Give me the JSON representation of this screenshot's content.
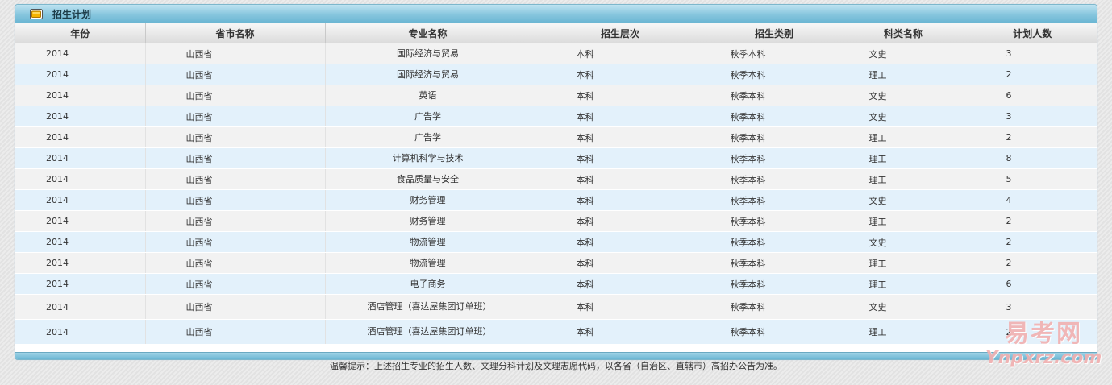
{
  "panel": {
    "title": "招生计划",
    "headers": [
      "年份",
      "省市名称",
      "专业名称",
      "招生层次",
      "招生类别",
      "科类名称",
      "计划人数"
    ],
    "rows": [
      [
        "2014",
        "山西省",
        "国际经济与贸易",
        "本科",
        "秋季本科",
        "文史",
        "3"
      ],
      [
        "2014",
        "山西省",
        "国际经济与贸易",
        "本科",
        "秋季本科",
        "理工",
        "2"
      ],
      [
        "2014",
        "山西省",
        "英语",
        "本科",
        "秋季本科",
        "文史",
        "6"
      ],
      [
        "2014",
        "山西省",
        "广告学",
        "本科",
        "秋季本科",
        "文史",
        "3"
      ],
      [
        "2014",
        "山西省",
        "广告学",
        "本科",
        "秋季本科",
        "理工",
        "2"
      ],
      [
        "2014",
        "山西省",
        "计算机科学与技术",
        "本科",
        "秋季本科",
        "理工",
        "8"
      ],
      [
        "2014",
        "山西省",
        "食品质量与安全",
        "本科",
        "秋季本科",
        "理工",
        "5"
      ],
      [
        "2014",
        "山西省",
        "财务管理",
        "本科",
        "秋季本科",
        "文史",
        "4"
      ],
      [
        "2014",
        "山西省",
        "财务管理",
        "本科",
        "秋季本科",
        "理工",
        "2"
      ],
      [
        "2014",
        "山西省",
        "物流管理",
        "本科",
        "秋季本科",
        "文史",
        "2"
      ],
      [
        "2014",
        "山西省",
        "物流管理",
        "本科",
        "秋季本科",
        "理工",
        "2"
      ],
      [
        "2014",
        "山西省",
        "电子商务",
        "本科",
        "秋季本科",
        "理工",
        "6"
      ],
      [
        "2014",
        "山西省",
        "酒店管理（喜达屋集团订单班）",
        "本科",
        "秋季本科",
        "文史",
        "3"
      ],
      [
        "2014",
        "山西省",
        "酒店管理（喜达屋集团订单班）",
        "本科",
        "秋季本科",
        "理工",
        "2"
      ]
    ]
  },
  "notice": "温馨提示：上述招生专业的招生人数、文理分科计划及文理志愿代码，以各省（自治区、直辖市）高招办公告为准。",
  "watermark": {
    "cn": "易考网",
    "en": "Ynpxrz.com"
  },
  "colors": {
    "header_bar": "#87c6de",
    "row_odd": "#f2f2f2",
    "row_even": "#e3f1fb"
  }
}
